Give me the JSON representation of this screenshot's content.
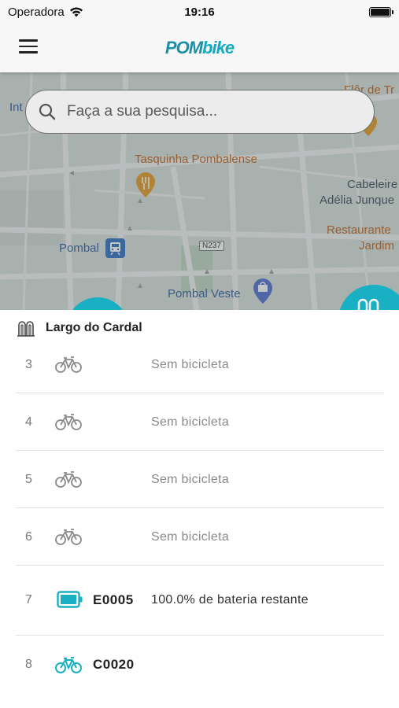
{
  "status_bar": {
    "carrier": "Operadora",
    "time": "19:16"
  },
  "header": {
    "logo_part1": "POM",
    "logo_part2": "bike"
  },
  "search": {
    "placeholder": "Faça a sua pesquisa..."
  },
  "map": {
    "labels": {
      "tasquinha": "Tasquinha Pombalense",
      "pombal_station": "Pombal",
      "road": "N237",
      "pombal_veste": "Pombal Veste",
      "cabeleireiro_line1": "Cabeleire",
      "cabeleireiro_line2": "Adélia Junque",
      "restaurante_line1": "Restaurante",
      "restaurante_line2": "Jardim",
      "top_right": "Flôr de Tr",
      "top_left": "Int"
    }
  },
  "station": {
    "name": "Largo do Cardal",
    "slots": [
      {
        "number": "3",
        "icon": "bicycle-icon",
        "code": "",
        "status": "Sem bicicleta"
      },
      {
        "number": "4",
        "icon": "bicycle-icon",
        "code": "",
        "status": "Sem bicicleta"
      },
      {
        "number": "5",
        "icon": "bicycle-icon",
        "code": "",
        "status": "Sem bicicleta"
      },
      {
        "number": "6",
        "icon": "bicycle-icon",
        "code": "",
        "status": "Sem bicicleta"
      },
      {
        "number": "7",
        "icon": "battery-icon",
        "code": "E0005",
        "status": "100.0% de bateria restante"
      },
      {
        "number": "8",
        "icon": "bicycle-icon",
        "code": "C0020",
        "status": ""
      }
    ]
  },
  "colors": {
    "accent": "#1ab0c4",
    "icon_gray": "#8a8a8a"
  }
}
